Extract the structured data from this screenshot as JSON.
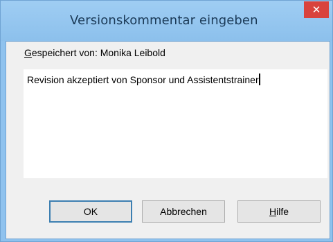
{
  "window": {
    "title": "Versionskommentar eingeben",
    "close_glyph": "✕"
  },
  "saved_by": {
    "access_key": "G",
    "label_rest": "espeichert von: Monika Leibold"
  },
  "comment": {
    "value": "Revision akzeptiert von Sponsor und Assistentstrainer"
  },
  "buttons": {
    "ok": "OK",
    "cancel": "Abbrechen",
    "help_access_key": "H",
    "help_rest": "ilfe"
  },
  "colors": {
    "titlebar": "#8fc2ee",
    "close": "#d9433d",
    "dialog_bg": "#f0f0f0",
    "default_button_border": "#3c7fb1"
  }
}
